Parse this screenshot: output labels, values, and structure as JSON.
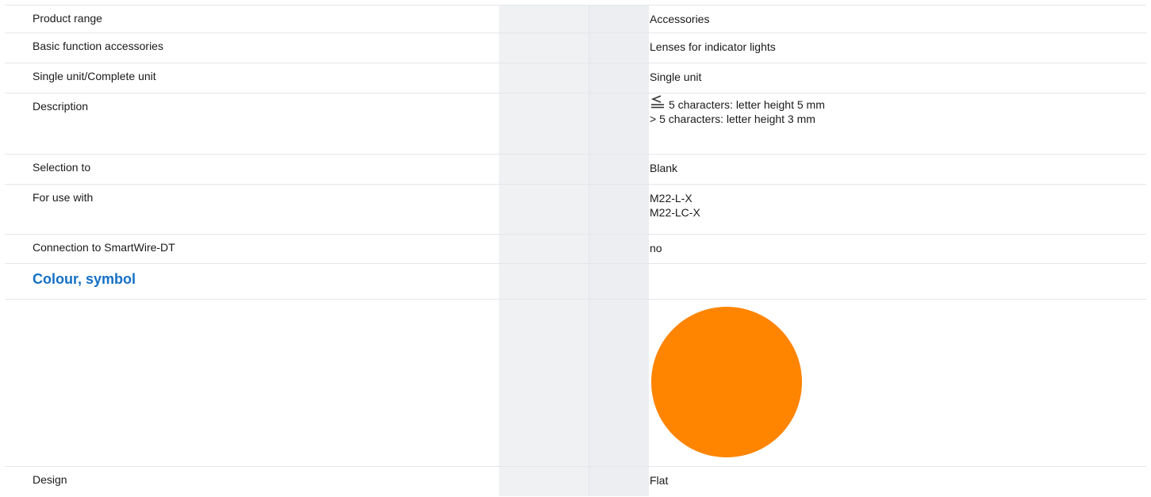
{
  "rows": [
    {
      "label": "Product range",
      "value": "Accessories"
    },
    {
      "label": "Basic function accessories",
      "value": "Lenses for indicator lights"
    },
    {
      "label": "Single unit/Complete unit",
      "value": "Single unit"
    },
    {
      "label": "Description",
      "value_line1": "5 characters: letter height 5 mm",
      "value_line2": "> 5 characters: letter height 3 mm",
      "icon": "less-than-or-equal-icon"
    },
    {
      "label": "Selection to",
      "value": "Blank"
    },
    {
      "label": "For use with",
      "value_line1": "M22-L-X",
      "value_line2": "M22-LC-X"
    },
    {
      "label": "Connection to SmartWire-DT",
      "value": "no"
    },
    {
      "section_title": "Colour, symbol"
    },
    {
      "swatch_color": "#ff8400",
      "swatch_icon": "orange-circle"
    },
    {
      "label": "Design",
      "value": "Flat"
    }
  ]
}
